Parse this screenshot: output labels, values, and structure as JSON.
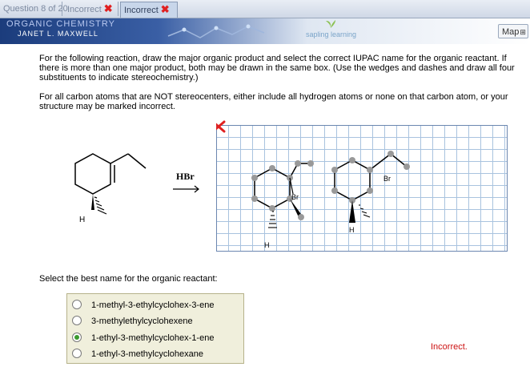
{
  "tabs": {
    "question": "Question 8 of 20",
    "attempt1": "Incorrect",
    "attempt2": "Incorrect"
  },
  "banner": {
    "course": "ORGANIC CHEMISTRY",
    "author": "JANET L. MAXWELL",
    "publisher": "sapling learning",
    "map_button": "Map"
  },
  "instructions": {
    "p1": "For the following reaction, draw the major organic product and select the correct IUPAC name for the organic reactant. If there is more than one major product, both may be drawn in the same box. (Use the wedges and dashes and draw all four substituents to indicate stereochemistry.)",
    "p2": "For all carbon atoms that are NOT stereocenters, either include all hydrogen atoms or none on that carbon atom, or your structure may be marked incorrect."
  },
  "reaction": {
    "reagent": "HBr",
    "reactant_h": "H"
  },
  "drawing": {
    "status_icon": "red-x-icon",
    "product1_br": "Br",
    "product1_h": "H",
    "product2_br": "Br",
    "product2_h": "H"
  },
  "question": {
    "label": "Select the best name for the organic reactant:",
    "options": [
      {
        "label": "1-methyl-3-ethylcyclohex-3-ene",
        "selected": false
      },
      {
        "label": "3-methylethylcyclohexene",
        "selected": false
      },
      {
        "label": "1-ethyl-3-methylcyclohex-1-ene",
        "selected": true
      },
      {
        "label": "1-ethyl-3-methylcyclohexane",
        "selected": false
      }
    ]
  },
  "feedback": "Incorrect.",
  "colors": {
    "error": "#cc1111",
    "selected": "#3a9a2e",
    "grid": "#a9c3df"
  }
}
